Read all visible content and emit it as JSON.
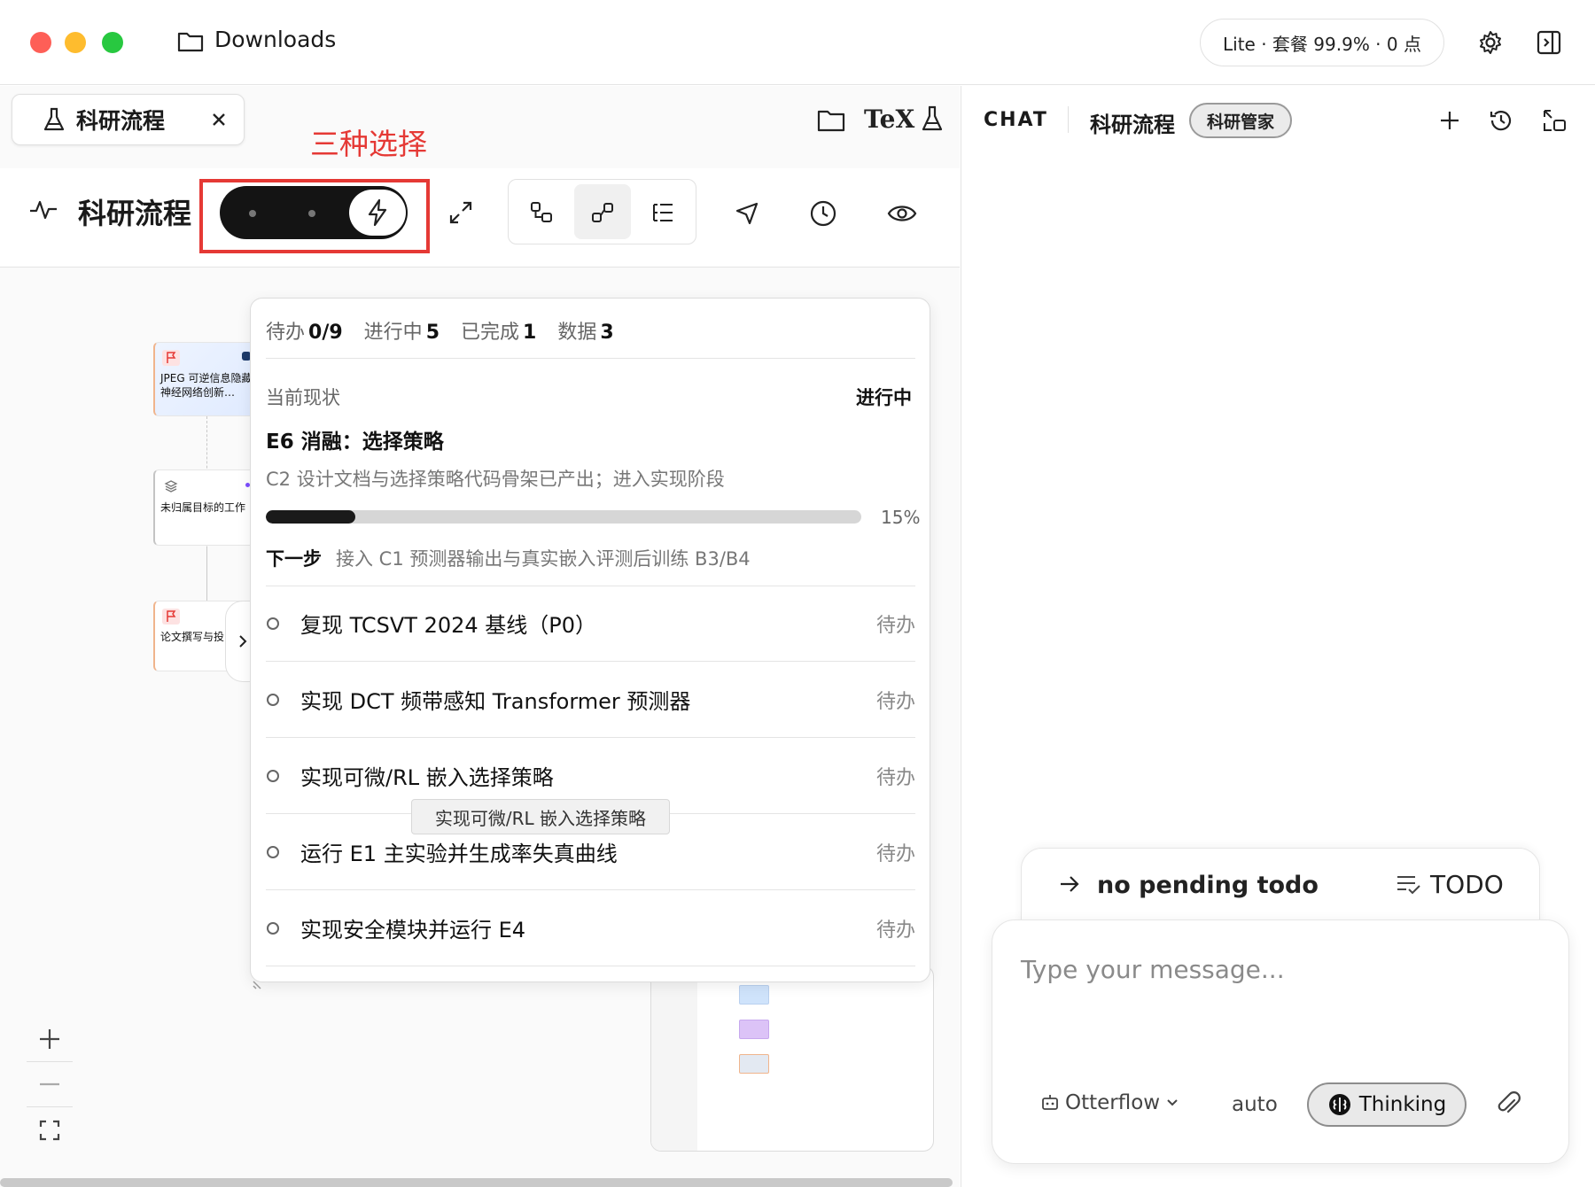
{
  "window": {
    "title": "Downloads",
    "plan_status": "Lite · 套餐 99.9% · 0 点"
  },
  "left": {
    "tab_label": "科研流程",
    "annotation": "三种选择",
    "page_title": "科研流程",
    "header_icons": [
      "folder-icon",
      "tex-icon",
      "flask-icon"
    ],
    "tex_label": "TeX"
  },
  "canvas": {
    "nodes": [
      {
        "label": "JPEG 可逆信息隐藏神经网络创新…"
      },
      {
        "label": "未归属目标的工作"
      },
      {
        "label": "论文撰写与投"
      }
    ]
  },
  "todo_panel": {
    "stats": [
      {
        "label": "待办",
        "value": "0/9"
      },
      {
        "label": "进行中",
        "value": "5"
      },
      {
        "label": "已完成",
        "value": "1"
      },
      {
        "label": "数据",
        "value": "3"
      }
    ],
    "current_label": "当前现状",
    "current_status": "进行中",
    "current_title": "E6 消融：选择策略",
    "current_desc": "C2 设计文档与选择策略代码骨架已产出；进入实现阶段",
    "progress": 0.15,
    "progress_text": "15%",
    "next_label": "下一步",
    "next_text": "接入 C1 预测器输出与真实嵌入评测后训练 B3/B4",
    "items": [
      {
        "text": "复现 TCSVT 2024 基线（P0）",
        "status": "待办"
      },
      {
        "text": "实现 DCT 频带感知 Transformer 预测器",
        "status": "待办"
      },
      {
        "text": "实现可微/RL 嵌入选择策略",
        "status": "待办"
      },
      {
        "text": "运行 E1 主实验并生成率失真曲线",
        "status": "待办"
      },
      {
        "text": "实现安全模块并运行 E4",
        "status": "待办"
      }
    ],
    "tooltip": "实现可微/RL 嵌入选择策略"
  },
  "minimap": {
    "swatches": [
      "#cfe3fb",
      "#dcc3f7",
      "#e3e9f2"
    ]
  },
  "chat": {
    "label": "CHAT",
    "context": "科研流程",
    "agent": "科研管家",
    "todo_status": "no pending todo",
    "todo_button": "TODO",
    "input_placeholder": "Type your message...",
    "model": "Otterflow",
    "mode": "auto",
    "thinking": "Thinking"
  },
  "colors": {
    "accent_red": "#e53935",
    "traffic_red": "#fe5f57",
    "traffic_yellow": "#febc2e",
    "traffic_green": "#28c840"
  }
}
